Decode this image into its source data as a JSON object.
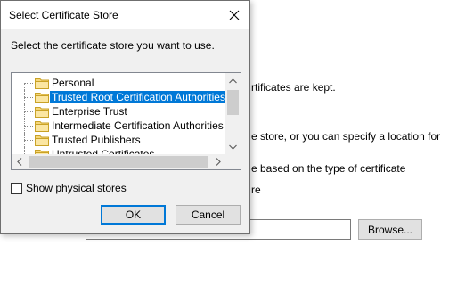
{
  "background": {
    "line1_tail": "rtificates are kept.",
    "line2_tail": "e store, or you can specify a location for",
    "line3_tail": "e based on the type of certificate",
    "line4_tail": "re",
    "path_value": "",
    "browse_label": "Browse..."
  },
  "dialog": {
    "title": "Select Certificate Store",
    "prompt": "Select the certificate store you want to use.",
    "stores": [
      {
        "label": "Personal",
        "selected": false
      },
      {
        "label": "Trusted Root Certification Authorities",
        "selected": true
      },
      {
        "label": "Enterprise Trust",
        "selected": false
      },
      {
        "label": "Intermediate Certification Authorities",
        "selected": false
      },
      {
        "label": "Trusted Publishers",
        "selected": false
      },
      {
        "label": "Untrusted Certificates",
        "selected": false
      }
    ],
    "show_physical_label": "Show physical stores",
    "show_physical_checked": false,
    "ok_label": "OK",
    "cancel_label": "Cancel"
  },
  "colors": {
    "selection": "#0078d7",
    "dialog_bg": "#f0f0f0",
    "folder": "#f6d77a"
  }
}
